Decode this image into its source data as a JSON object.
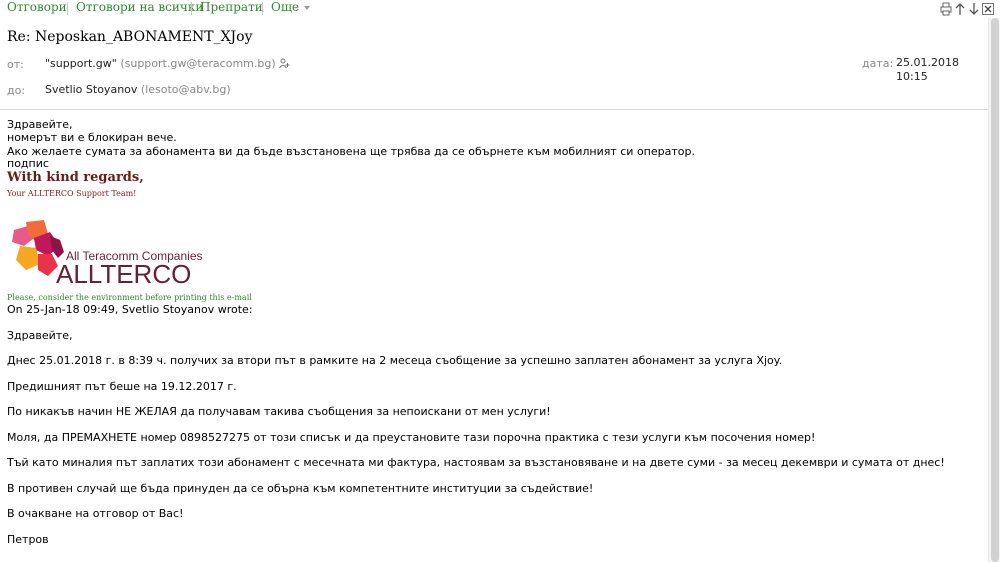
{
  "toolbar": {
    "reply": "Отговори",
    "reply_all": "Отговори на всички",
    "forward": "Препрати",
    "more": "Още"
  },
  "toolbar_icons": [
    "print-icon",
    "up-arrow-icon",
    "down-arrow-icon",
    "close-icon"
  ],
  "header": {
    "subject": "Re: Neposkan_ABONAMENT_XJoy",
    "from_label": "от:",
    "from_name": "\"support.gw\"",
    "from_email": "(support.gw@teracomm.bg)",
    "to_label": "до:",
    "to_name": "Svetlio Stoyanov",
    "to_email": "(lesoto@abv.bg)",
    "date_label": "дата:",
    "date": "25.01.2018",
    "time": "10:15"
  },
  "message": {
    "lines": [
      "Здравейте,",
      "номерът ви е блокиран вече.",
      "Ако желаете сумата за абонамента ви да бъде възстановена ще трябва да се обърнете към мобилният си оператор.",
      "подпис"
    ],
    "regards": "With kind regards,",
    "team": "Your ALLTERCO Support Team!",
    "logo_tagline": "All Teracomm Companies",
    "logo_name": "ALLTERCO",
    "environment_note": "Please, consider the environment before printing this e-mail",
    "quote_header": "On 25-Jan-18 09:49, Svetlio Stoyanov wrote:",
    "quote_paragraphs": [
      "Здравейте,",
      "Днес 25.01.2018 г. в 8:39 ч. получих за втори път в рамките на 2 месеца съобщение за успешно заплатен абонамент за услуга Xjoy.",
      "Предишният път беше на 19.12.2017 г.",
      "По никакъв начин НЕ ЖЕЛАЯ да получавам такива съобщения за непоискани от мен услуги!",
      "Моля, да ПРЕМАХНЕТЕ номер 0898527275 от този списък и да преустановите тази порочна практика с тези услуги към посочения номер!",
      "Тъй като миналия път заплатих този абонамент с месечната ми фактура, настоявам за възстановяване и на двете суми - за месец декември и сумата от днес!",
      "В противен случай ще бъда принуден да се обърна към компетентните институции за съдействие!",
      "В очакване на отговор от Вас!",
      "Петров"
    ]
  },
  "colors": {
    "toolbar_link": "#2e8b2e",
    "regards": "#6b1a1a",
    "logo_text": "#6b1e3a",
    "muted": "#888888"
  }
}
